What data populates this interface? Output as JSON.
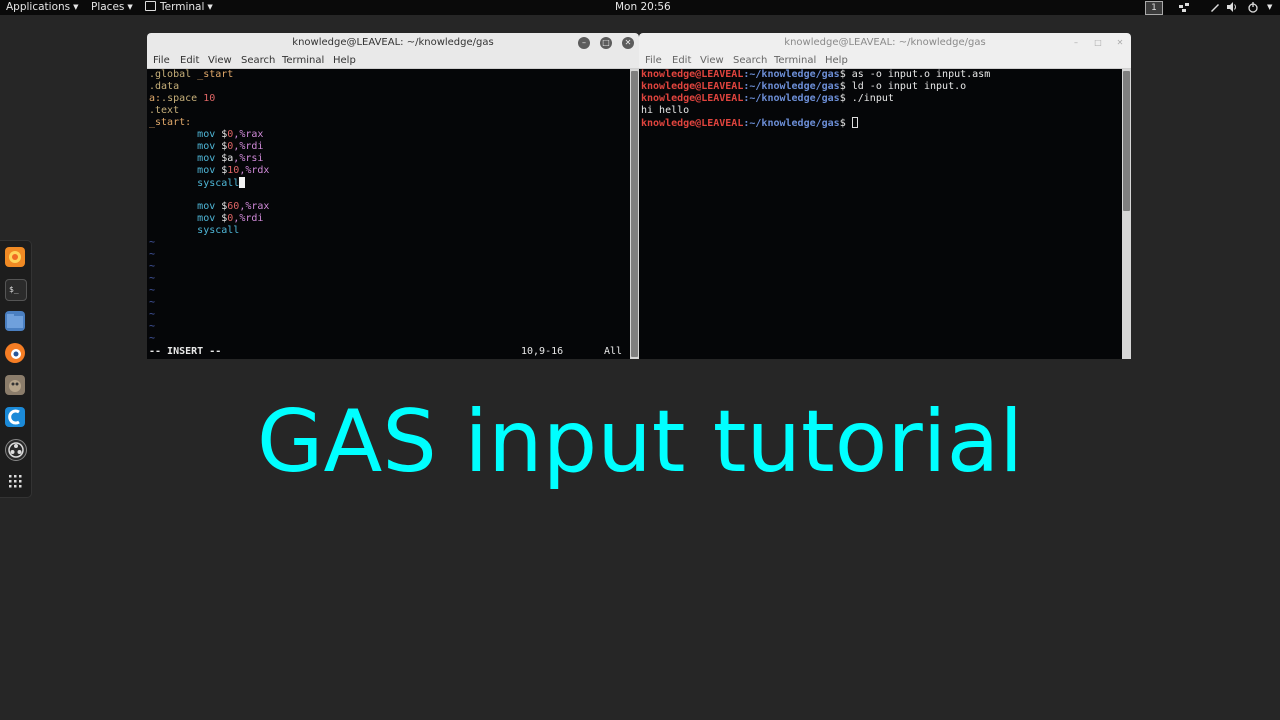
{
  "topbar": {
    "applications": "Applications",
    "places": "Places",
    "terminal": "Terminal",
    "clock": "Mon 20:56",
    "workspace": "1"
  },
  "dock": {
    "apps": [
      "firefox-icon",
      "terminal-icon",
      "files-icon",
      "blender-icon",
      "gimp-icon",
      "code-icon",
      "obs-icon",
      "app-grid-icon"
    ]
  },
  "left_window": {
    "title": "knowledge@LEAVEAL: ~/knowledge/gas",
    "menu": [
      "File",
      "Edit",
      "View",
      "Search",
      "Terminal",
      "Help"
    ],
    "code": {
      "l1_dir": ".global",
      "l1_rest": " _start",
      "l2_dir": ".data",
      "l3_label": "a:",
      "l3_dir": ".space",
      "l3_num": " 10",
      "l4_dir": ".text",
      "l5_label": "_start:",
      "indent": "        ",
      "mov": "mov",
      "syscall": "syscall",
      "r1_a": " $",
      "r1_num": "0",
      "r1_reg": ",%rax",
      "r2_a": " $",
      "r2_num": "0",
      "r2_reg": ",%rdi",
      "r3_a": " $a",
      "r3_reg": ",%rsi",
      "r4_a": " $",
      "r4_num": "10",
      "r4_reg": ",%rdx",
      "r5_a": " $",
      "r5_num": "60",
      "r5_reg": ",%rax",
      "r6_a": " $",
      "r6_num": "0",
      "r6_reg": ",%rdi",
      "tilde": "~"
    },
    "status_mode": "-- INSERT --",
    "status_pos": "10,9-16",
    "status_all": "All"
  },
  "right_window": {
    "title": "knowledge@LEAVEAL: ~/knowledge/gas",
    "menu": [
      "File",
      "Edit",
      "View",
      "Search",
      "Terminal",
      "Help"
    ],
    "prompt_user": "knowledge@LEAVEAL",
    "prompt_path": ":~/knowledge/gas",
    "prompt_sym": "$",
    "cmd1": " as -o input.o input.asm",
    "cmd2": " ld -o input input.o",
    "cmd3": " ./input",
    "output1": "hi hello"
  },
  "headline": "GAS input tutorial",
  "colors": {
    "headline": "#00ffff",
    "prompt_user": "#e0443e",
    "prompt_path": "#6c8ed6",
    "background": "#262626"
  }
}
